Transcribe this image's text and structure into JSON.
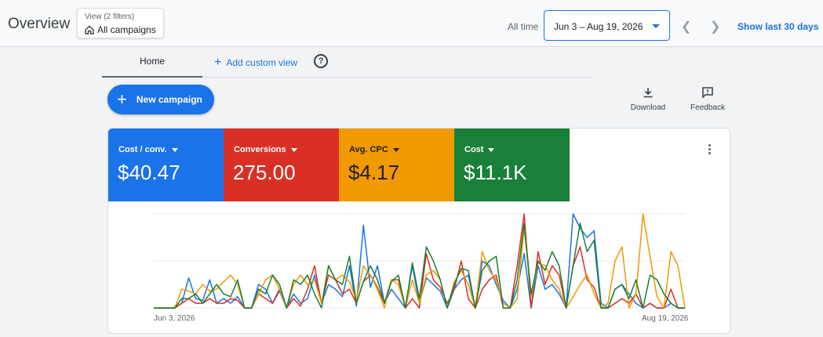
{
  "header": {
    "title": "Overview",
    "view_filters": "View (2 filters)",
    "view_name": "All campaigns",
    "range_label": "All time",
    "date_range": "Jun 3 – Aug 19, 2026",
    "show_last": "Show last 30 days"
  },
  "tabs": {
    "home": "Home",
    "add_view": "Add custom view",
    "help": "?"
  },
  "actions": {
    "new_campaign": "New campaign",
    "download": "Download",
    "feedback": "Feedback"
  },
  "metrics": [
    {
      "label": "Cost / conv.",
      "value": "$40.47",
      "color": "#1a73e8",
      "text_color": "#ffffff"
    },
    {
      "label": "Conversions",
      "value": "275.00",
      "color": "#d93025",
      "text_color": "#ffffff"
    },
    {
      "label": "Avg. CPC",
      "value": "$4.17",
      "color": "#f29900",
      "text_color": "#202124"
    },
    {
      "label": "Cost",
      "value": "$11.1K",
      "color": "#188038",
      "text_color": "#ffffff"
    }
  ],
  "chart_data": {
    "type": "line",
    "x_start": "Jun 3, 2026",
    "x_end": "Aug 19, 2026",
    "ylim": [
      0,
      1
    ],
    "grid": true,
    "series": [
      {
        "color": "#1a73e8",
        "values": [
          0,
          0,
          0,
          0,
          0.05,
          0.32,
          0.1,
          0.08,
          0.3,
          0.05,
          0.1,
          0.05,
          0.12,
          0,
          0,
          0.25,
          0.2,
          0.05,
          0.18,
          0,
          0.15,
          0.05,
          0.1,
          0.35,
          0.05,
          0.25,
          0.2,
          0.12,
          0.45,
          0.02,
          0.88,
          0.22,
          0.45,
          0.05,
          0.2,
          0.1,
          0,
          0.45,
          0.05,
          0.32,
          0.25,
          0.18,
          0,
          0.2,
          0.3,
          0.35,
          0,
          0.5,
          0.45,
          0.25,
          0.08,
          0,
          0.2,
          0.58,
          0,
          0.45,
          0.2,
          0.25,
          0.15,
          0,
          1,
          0.85,
          0.75,
          0.82,
          0.05,
          0,
          0.2,
          0.25,
          0.15,
          0.05,
          0,
          0.05,
          0,
          0,
          0.05,
          0,
          0
        ]
      },
      {
        "color": "#d93025",
        "values": [
          0,
          0,
          0,
          0,
          0.05,
          0.1,
          0.05,
          0.05,
          0.1,
          0.05,
          0.05,
          0.1,
          0.08,
          0,
          0,
          0.15,
          0.1,
          0.05,
          0.2,
          0,
          0.1,
          0.02,
          0.2,
          0.45,
          0.05,
          0.35,
          0.3,
          0.15,
          0.2,
          0.05,
          0.28,
          0.35,
          0.22,
          0.05,
          0.3,
          0.3,
          0,
          0.1,
          0,
          0.58,
          0.3,
          0.22,
          0.05,
          0.2,
          0.5,
          0.1,
          0,
          0.2,
          0.3,
          0.35,
          0,
          0,
          0.45,
          1,
          0,
          0.6,
          0.25,
          0.45,
          0.35,
          0,
          0.45,
          0.65,
          0.3,
          0.22,
          0,
          0,
          0.05,
          0.1,
          0.05,
          0.15,
          0,
          0.05,
          0,
          0,
          0.2,
          0,
          0
        ]
      },
      {
        "color": "#f29900",
        "values": [
          0,
          0,
          0,
          0,
          0.2,
          0.18,
          0.15,
          0.25,
          0.18,
          0.2,
          0.28,
          0.35,
          0.25,
          0,
          0,
          0.15,
          0.3,
          0.35,
          0.2,
          0,
          0.25,
          0.35,
          0.25,
          0.3,
          0.05,
          0.45,
          0.3,
          0.35,
          0.28,
          0.08,
          0.45,
          0.35,
          0.2,
          0,
          0.3,
          0.25,
          0,
          0.3,
          0.05,
          0.35,
          0.4,
          0.3,
          0,
          0.28,
          0.4,
          0.25,
          0,
          0.6,
          0.4,
          0.3,
          0.05,
          0,
          0.1,
          0.85,
          0.12,
          0.48,
          0.45,
          0.3,
          0.2,
          0,
          0.12,
          0.25,
          0.35,
          0.15,
          0,
          0.05,
          0.5,
          0.65,
          0,
          0.15,
          1,
          0.55,
          0.12,
          0,
          0.6,
          0.45,
          0
        ]
      },
      {
        "color": "#188038",
        "values": [
          0,
          0,
          0,
          0,
          0.1,
          0.1,
          0.15,
          0.05,
          0.15,
          0.25,
          0.15,
          0.12,
          0.3,
          0,
          0,
          0.2,
          0.15,
          0.35,
          0.25,
          0,
          0.3,
          0.25,
          0.35,
          0.15,
          0,
          0.45,
          0.3,
          0.25,
          0.55,
          0.05,
          0.28,
          0.45,
          0.3,
          0.05,
          0.28,
          0.35,
          0,
          0.48,
          0.1,
          0.65,
          0.5,
          0.3,
          0,
          0.25,
          0.42,
          0.4,
          0,
          0.4,
          0.5,
          0.55,
          0,
          0,
          0.3,
          0.9,
          0.15,
          0.5,
          0.4,
          0.6,
          0.45,
          0,
          0.45,
          0.9,
          0.6,
          0.72,
          0,
          0,
          0.2,
          0.25,
          0.1,
          0.3,
          0,
          0.35,
          0.3,
          0.15,
          0.05,
          0,
          0
        ]
      }
    ]
  }
}
